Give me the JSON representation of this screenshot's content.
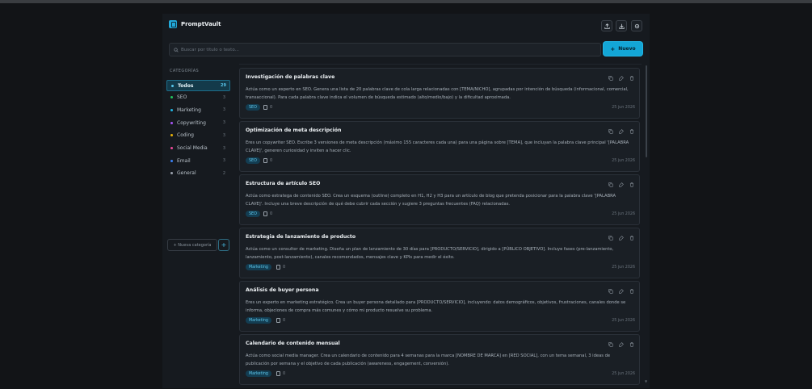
{
  "app": {
    "name": "PromptVault"
  },
  "header": {
    "upload_icon": "upload-icon",
    "download_icon": "download-icon",
    "settings_icon": "gear-icon"
  },
  "search": {
    "placeholder": "Buscar por título o texto...",
    "value": ""
  },
  "new_button": {
    "label": "Nuevo",
    "icon": "plus"
  },
  "sidebar": {
    "heading": "CATEGORÍAS",
    "items": [
      {
        "label": "Todos",
        "count": "29",
        "color": "#58c4ea",
        "active": true
      },
      {
        "label": "SEO",
        "count": "3",
        "color": "#22c55e"
      },
      {
        "label": "Marketing",
        "count": "3",
        "color": "#22b8e6"
      },
      {
        "label": "Copywriting",
        "count": "3",
        "color": "#a855f7"
      },
      {
        "label": "Coding",
        "count": "3",
        "color": "#eab308"
      },
      {
        "label": "Social Media",
        "count": "3",
        "color": "#ec4899"
      },
      {
        "label": "Email",
        "count": "3",
        "color": "#3b82f6"
      },
      {
        "label": "General",
        "count": "2",
        "color": "#9ca3af"
      }
    ],
    "new_category_label": "+ Nueva categoría",
    "add_label": "+"
  },
  "cards": [
    {
      "title": "Investigación de palabras clave",
      "body": "Actúa como un experto en SEO. Genera una lista de 20 palabras clave de cola larga relacionadas con [TEMA/NICHO], agrupadas por intención de búsqueda (informacional, comercial, transaccional). Para cada palabra clave indica el volumen de búsqueda estimado (alto/medio/bajo) y la dificultad aproximada.",
      "tag": "SEO",
      "uses": "0",
      "date": "25 jun 2026"
    },
    {
      "title": "Optimización de meta descripción",
      "body": "Eres un copywriter SEO. Escribe 3 versiones de meta descripción (máximo 155 caracteres cada una) para una página sobre [TEMA], que incluyan la palabra clave principal '[PALABRA CLAVE]', generen curiosidad y inviten a hacer clic.",
      "tag": "SEO",
      "uses": "0",
      "date": "25 jun 2026"
    },
    {
      "title": "Estructura de artículo SEO",
      "body": "Actúa como estratega de contenido SEO. Crea un esquema (outline) completo en H1, H2 y H3 para un artículo de blog que pretenda posicionar para la palabra clave '[PALABRA CLAVE]'. Incluye una breve descripción de qué debe cubrir cada sección y sugiere 3 preguntas frecuentes (FAQ) relacionadas.",
      "tag": "SEO",
      "uses": "0",
      "date": "25 jun 2026"
    },
    {
      "title": "Estrategia de lanzamiento de producto",
      "body": "Actúa como un consultor de marketing. Diseña un plan de lanzamiento de 30 días para [PRODUCTO/SERVICIO], dirigido a [PÚBLICO OBJETIVO]. Incluye fases (pre-lanzamiento, lanzamiento, post-lanzamiento), canales recomendados, mensajes clave y KPIs para medir el éxito.",
      "tag": "Marketing",
      "uses": "0",
      "date": "25 jun 2026"
    },
    {
      "title": "Análisis de buyer persona",
      "body": "Eres un experto en marketing estratégico. Crea un buyer persona detallado para [PRODUCTO/SERVICIO], incluyendo: datos demográficos, objetivos, frustraciones, canales donde se informa, objeciones de compra más comunes y cómo mi producto resuelve su problema.",
      "tag": "Marketing",
      "uses": "0",
      "date": "25 jun 2026"
    },
    {
      "title": "Calendario de contenido mensual",
      "body": "Actúa como social media manager. Crea un calendario de contenido para 4 semanas para la marca [NOMBRE DE MARCA] en [RED SOCIAL], con un tema semanal, 3 ideas de publicación por semana y el objetivo de cada publicación (awareness, engagement, conversión).",
      "tag": "Marketing",
      "uses": "0",
      "date": "25 jun 2026"
    }
  ]
}
